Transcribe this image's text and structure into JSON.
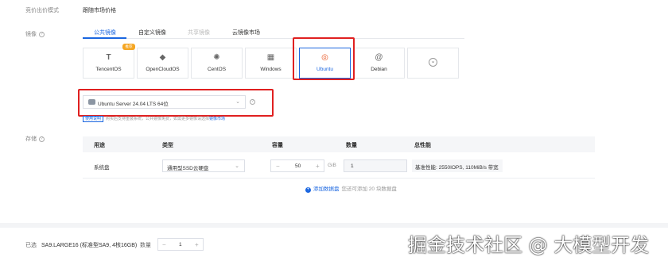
{
  "billing": {
    "label": "竞价出价模式",
    "value": "跟随市场价格"
  },
  "image": {
    "label": "镜像",
    "tabs": [
      {
        "label": "公共镜像"
      },
      {
        "label": "自定义镜像"
      },
      {
        "label": "共享镜像"
      },
      {
        "label": "云镜像市场"
      }
    ],
    "tiles": [
      {
        "name": "TencentOS",
        "icon": "T"
      },
      {
        "name": "OpenCloudOS",
        "icon": "◆"
      },
      {
        "name": "CentOS",
        "icon": "✺"
      },
      {
        "name": "Windows",
        "icon": "▦"
      },
      {
        "name": "Ubuntu",
        "icon": "◎"
      },
      {
        "name": "Debian",
        "icon": "@"
      },
      {
        "name": "",
        "icon": "⌄"
      }
    ],
    "badge": "推荐",
    "selected_version": "Ubuntu Server 24.04 LTS 64位",
    "hint_tag": "使用说明",
    "hint_text": "购买后支持重装系统，公共镜像免费，如需更多镜像请选择",
    "hint_link": "镜像市场"
  },
  "storage": {
    "label": "存储",
    "headers": [
      "用途",
      "类型",
      "容量",
      "数量",
      "总性能"
    ],
    "row": {
      "usage": "系统盘",
      "type": "通用型SSD云硬盘",
      "capacity": "50",
      "unit": "GiB",
      "count": "1",
      "performance": "基准性能: 2550IOPS, 110MiB/s 带宽"
    },
    "add_label": "添加数据盘",
    "add_hint": "您还可添加 20 块数据盘"
  },
  "footer": {
    "selected_label": "已选",
    "selected_value": "SA9.LARGE16 (标准型SA9, 4核16GB)",
    "qty_label": "数量",
    "qty_value": "1"
  },
  "watermark": "掘金技术社区 @ 大模型开发"
}
